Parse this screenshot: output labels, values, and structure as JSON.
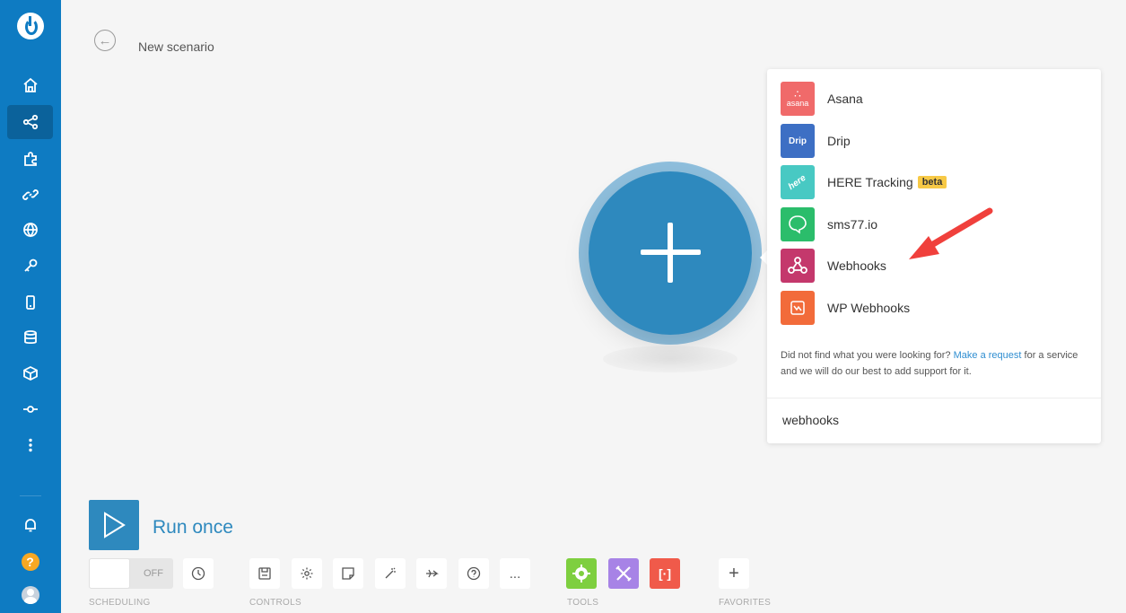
{
  "header": {
    "title": "New scenario",
    "back_icon": "arrow-left-icon"
  },
  "sidebar": {
    "items": [
      {
        "icon": "home-icon"
      },
      {
        "icon": "share-icon",
        "active": true
      },
      {
        "icon": "puzzle-icon"
      },
      {
        "icon": "link-icon"
      },
      {
        "icon": "globe-icon"
      },
      {
        "icon": "key-icon"
      },
      {
        "icon": "mobile-icon"
      },
      {
        "icon": "database-icon"
      },
      {
        "icon": "cube-icon"
      },
      {
        "icon": "flow-icon"
      },
      {
        "icon": "more-vertical-icon"
      }
    ],
    "bottom": {
      "notifications_icon": "bell-icon",
      "help_label": "?",
      "avatar_icon": "user-avatar-icon"
    }
  },
  "app_list": {
    "items": [
      {
        "name": "Asana",
        "icon_text": "asana",
        "color": "#f06a6a"
      },
      {
        "name": "Drip",
        "icon_text": "Drip",
        "color": "#3d6fc4"
      },
      {
        "name": "HERE Tracking",
        "icon_text": "here",
        "color": "#48c9c3",
        "badge": "beta"
      },
      {
        "name": "sms77.io",
        "icon_text": "",
        "color": "#2bbd6b"
      },
      {
        "name": "Webhooks",
        "icon_text": "",
        "color": "#c4386c"
      },
      {
        "name": "WP Webhooks",
        "icon_text": "",
        "color": "#f26b3a"
      }
    ],
    "note_prefix": "Did not find what you were looking for?",
    "note_link": "Make a request",
    "note_suffix": "for a service and we will do our best to add support for it.",
    "search_value": "webhooks"
  },
  "bottom_bar": {
    "run_label": "Run once",
    "toggle_label": "OFF",
    "sections": {
      "scheduling": "SCHEDULING",
      "controls": "CONTROLS",
      "tools": "TOOLS",
      "favorites": "FAVORITES"
    },
    "controls": [
      "clock-icon",
      "save-icon",
      "gear-icon",
      "note-icon",
      "magic-wand-icon",
      "airplane-icon",
      "help-circle-icon",
      "more-icon"
    ],
    "tools": [
      {
        "icon": "gear-icon",
        "color": "#7ecf3f"
      },
      {
        "icon": "tools-icon",
        "color": "#a783e6"
      },
      {
        "icon": "brackets-icon",
        "color": "#f05a4a"
      }
    ],
    "favorites_add": "+",
    "more_label": "..."
  }
}
